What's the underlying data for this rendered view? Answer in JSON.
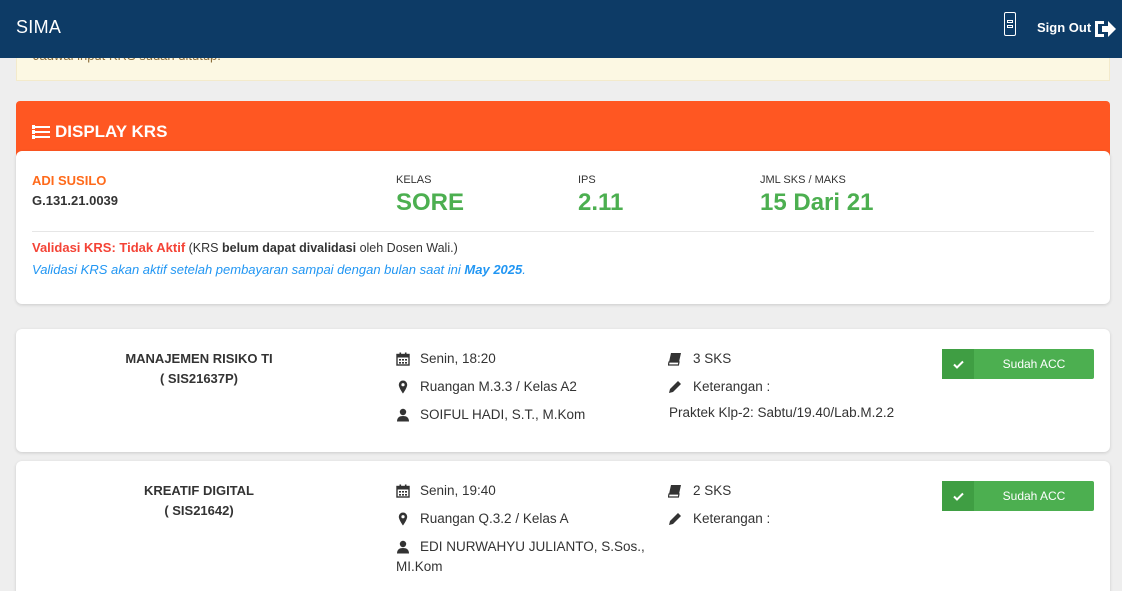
{
  "navbar": {
    "brand": "SIMA",
    "signout_label": "Sign Out",
    "qr_icon": "qr-code-icon",
    "signout_icon": "sign-out-icon"
  },
  "alert": {
    "text": "Jadwal input KRS sudah ditutup."
  },
  "krs": {
    "title": "DISPLAY KRS",
    "icon": "list-icon"
  },
  "student": {
    "name": "ADI SUSILO",
    "nim": "G.131.21.0039",
    "kelas_label": "KELAS",
    "kelas_value": "SORE",
    "ips_label": "IPS",
    "ips_value": "2.11",
    "sks_label": "JML SKS / MAKS",
    "sks_value": "15 Dari 21"
  },
  "validation": {
    "status": "Validasi KRS: Tidak Aktif",
    "note_prefix": "(KRS",
    "note_bold": "belum dapat divalidasi",
    "note_suffix": "oleh Dosen Wali.)",
    "info_prefix": "Validasi KRS akan aktif setelah pembayaran sampai dengan bulan saat ini",
    "info_month": "May 2025",
    "info_suffix": "."
  },
  "courses": [
    {
      "name": "MANAJEMEN RISIKO TI",
      "code": "( SIS21637P)",
      "schedule": "Senin, 18:20",
      "room": "Ruangan M.3.3 / Kelas A2",
      "lecturer": "SOIFUL HADI, S.T., M.Kom",
      "sks": "3 SKS",
      "keterangan_label": "Keterangan :",
      "keterangan": "Praktek Klp-2: Sabtu/19.40/Lab.M.2.2",
      "status": "Sudah ACC"
    },
    {
      "name": "KREATIF DIGITAL",
      "code": "( SIS21642)",
      "schedule": "Senin, 19:40",
      "room": "Ruangan Q.3.2 / Kelas A",
      "lecturer": "EDI NURWAHYU JULIANTO, S.Sos., MI.Kom",
      "sks": "2 SKS",
      "keterangan_label": "Keterangan :",
      "keterangan": "",
      "status": "Sudah ACC"
    }
  ],
  "colors": {
    "navbar": "#0d3b66",
    "header": "#ff5722",
    "accent_green": "#4caf50",
    "name_orange": "#ff6a1a",
    "red": "#f44336",
    "blue": "#2196f3"
  }
}
